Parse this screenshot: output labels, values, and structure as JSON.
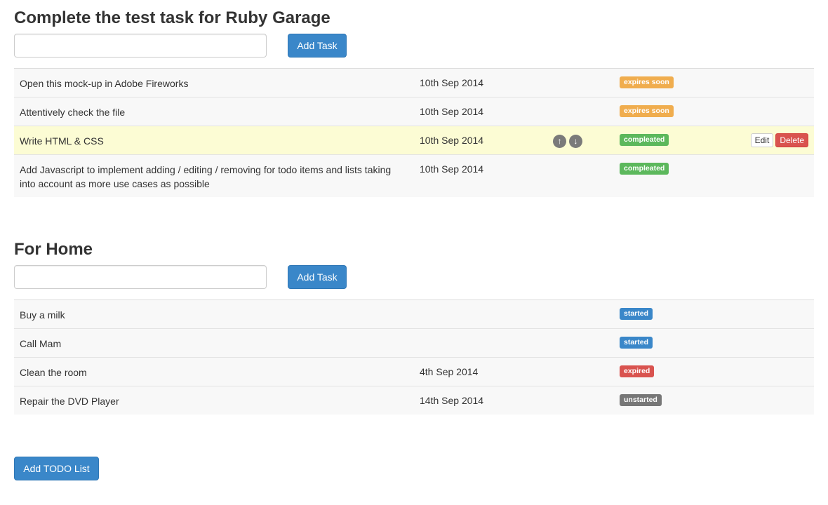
{
  "status_colors": {
    "expires soon": "#f0ad4e",
    "compleated": "#5cb85c",
    "started": "#3a87c9",
    "expired": "#d9534f",
    "unstarted": "#777777"
  },
  "projects": [
    {
      "title": "Complete the test task for Ruby Garage",
      "input_value": "",
      "input_placeholder": "",
      "add_task_label": "Add Task",
      "tasks": [
        {
          "name": "Open this mock-up in Adobe Fireworks",
          "date": "10th Sep 2014",
          "status": "expires soon"
        },
        {
          "name": "Attentively check the file",
          "date": "10th Sep 2014",
          "status": "expires soon"
        },
        {
          "name": "Write HTML & CSS",
          "date": "10th Sep 2014",
          "status": "compleated",
          "highlighted": true,
          "up_icon": "arrow-up-icon",
          "down_icon": "arrow-down-icon",
          "up_glyph": "↑",
          "down_glyph": "↓",
          "edit_label": "Edit",
          "delete_label": "Delete"
        },
        {
          "name": "Add Javascript to implement adding / editing / removing for todo items and lists taking into account as more use cases as possible",
          "date": "10th Sep 2014",
          "status": "compleated"
        }
      ]
    },
    {
      "title": "For Home",
      "input_value": "",
      "input_placeholder": "",
      "add_task_label": "Add Task",
      "tasks": [
        {
          "name": "Buy a milk",
          "date": "",
          "status": "started"
        },
        {
          "name": "Call Mam",
          "date": "",
          "status": "started"
        },
        {
          "name": "Clean the room",
          "date": "4th Sep 2014",
          "status": "expired"
        },
        {
          "name": "Repair the DVD Player",
          "date": "14th Sep 2014",
          "status": "unstarted"
        }
      ]
    }
  ],
  "add_list_label": "Add TODO List"
}
